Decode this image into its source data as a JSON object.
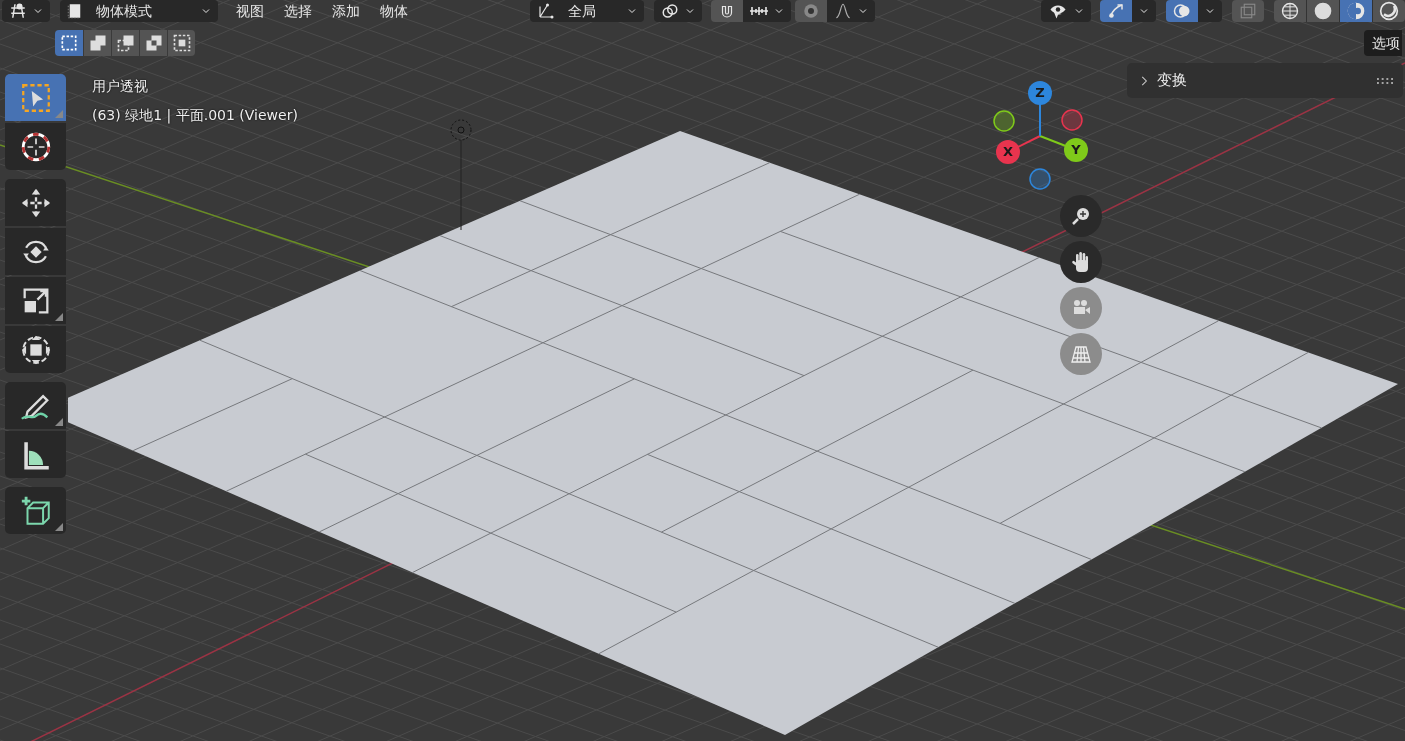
{
  "header": {
    "mode": {
      "label": "物体模式"
    },
    "menus": [
      "视图",
      "选择",
      "添加",
      "物体"
    ],
    "orientation": {
      "label": "全局"
    },
    "snap": {
      "on": false
    },
    "proportional": {
      "on": false
    },
    "gizmos": {
      "on": true
    },
    "overlays": {
      "on": true
    },
    "xray": {
      "on": false
    },
    "shading": [
      {
        "kind": "wireframe",
        "selected": false
      },
      {
        "kind": "solid",
        "selected": false
      },
      {
        "kind": "material",
        "selected": true
      },
      {
        "kind": "rendered",
        "selected": false
      }
    ]
  },
  "select_modes": [
    {
      "kind": "new",
      "selected": true
    },
    {
      "kind": "extend",
      "selected": false
    },
    {
      "kind": "subtract",
      "selected": false
    },
    {
      "kind": "invert",
      "selected": false
    },
    {
      "kind": "intersect",
      "selected": false
    }
  ],
  "options_button": "选项",
  "toolbar": [
    {
      "tools": [
        {
          "kind": "select_box",
          "selected": true,
          "has_variants": true
        },
        {
          "kind": "cursor",
          "selected": false,
          "has_variants": false
        }
      ]
    },
    {
      "tools": [
        {
          "kind": "move",
          "selected": false,
          "has_variants": false
        },
        {
          "kind": "rotate",
          "selected": false,
          "has_variants": false
        },
        {
          "kind": "scale",
          "selected": false,
          "has_variants": true
        },
        {
          "kind": "transform",
          "selected": false,
          "has_variants": false
        }
      ]
    },
    {
      "tools": [
        {
          "kind": "annotate",
          "selected": false,
          "has_variants": true
        },
        {
          "kind": "measure",
          "selected": false,
          "has_variants": false
        }
      ]
    },
    {
      "tools": [
        {
          "kind": "add_cube",
          "selected": false,
          "has_variants": true
        }
      ]
    }
  ],
  "viewport": {
    "view_name": "用户透视",
    "object_info": "(63) 绿地1 | 平面.001 (Viewer)"
  },
  "sidebar_panel": {
    "title": "变换",
    "expanded": false
  },
  "nav_gizmo": {
    "axes": [
      {
        "label": "X",
        "color": "#e8344e"
      },
      {
        "label": "Y",
        "color": "#7fca1a"
      },
      {
        "label": "Z",
        "color": "#2d86dc"
      }
    ]
  }
}
